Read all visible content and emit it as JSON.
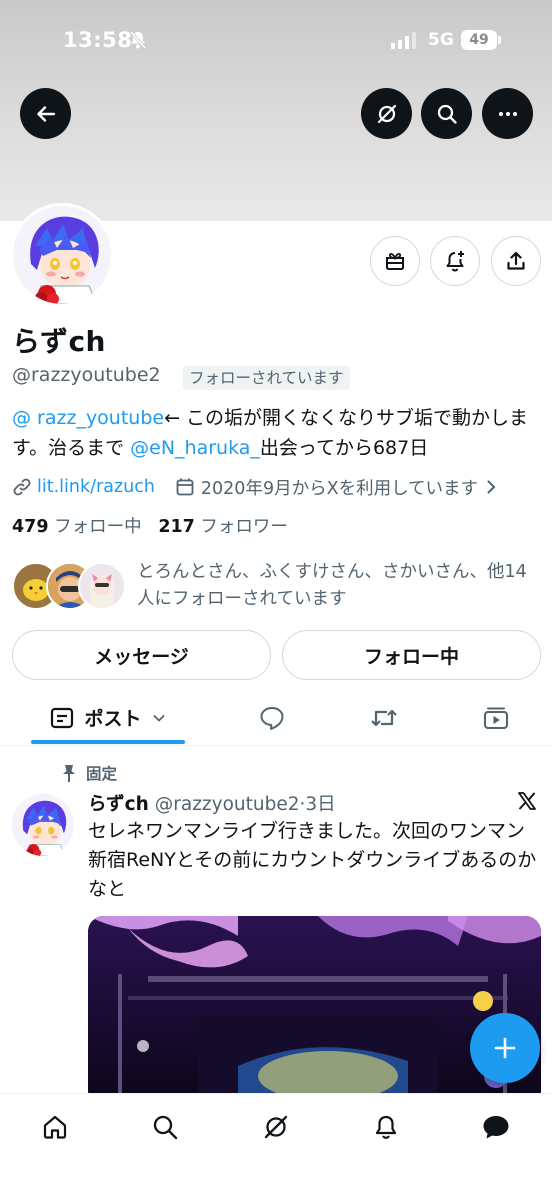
{
  "status_bar": {
    "time": "13:58",
    "network": "5G",
    "battery": "49"
  },
  "header": {
    "back_icon": "arrow-left-icon",
    "grok_icon": "grok-icon",
    "search_icon": "search-icon",
    "more_icon": "more-horizontal-icon"
  },
  "profile": {
    "display_name": "らずch",
    "handle": "@razzyoutube2",
    "follows_you": "フォローされています",
    "bio": {
      "mention1": "@ razz_youtube",
      "text1": "← この垢が開くなくなりサブ垢で動かします。治るまで ",
      "mention2": "@eN_haruka_",
      "text2": "出会ってから687日"
    },
    "link": "lit.link/razuch",
    "joined": "2020年9月からXを利用しています",
    "following_count": "479",
    "following_label": "フォロー中",
    "followers_count": "217",
    "followers_label": "フォロワー",
    "followed_by": "とろんとさん、ふくすけさん、さかいさん、他14人にフォローされています",
    "message_button": "メッセージ",
    "following_button": "フォロー中"
  },
  "tabs": [
    {
      "label": "ポスト",
      "icon": "posts-icon",
      "active": true
    },
    {
      "icon": "replies-icon"
    },
    {
      "icon": "repost-icon"
    },
    {
      "icon": "media-icon"
    }
  ],
  "post": {
    "pinned_label": "固定",
    "author_name": "らずch",
    "author_handle": "@razzyoutube2",
    "time": "3日",
    "text": "セレネワンマンライブ行きました。次回のワンマン新宿ReNYとその前にカウントダウンライブあるのかなと"
  },
  "bottom_nav": [
    "home-icon",
    "search-icon",
    "grok-icon",
    "notifications-icon",
    "messages-icon"
  ],
  "colors": {
    "accent": "#1d9bf0",
    "text": "#0f1419",
    "secondary": "#536471"
  }
}
